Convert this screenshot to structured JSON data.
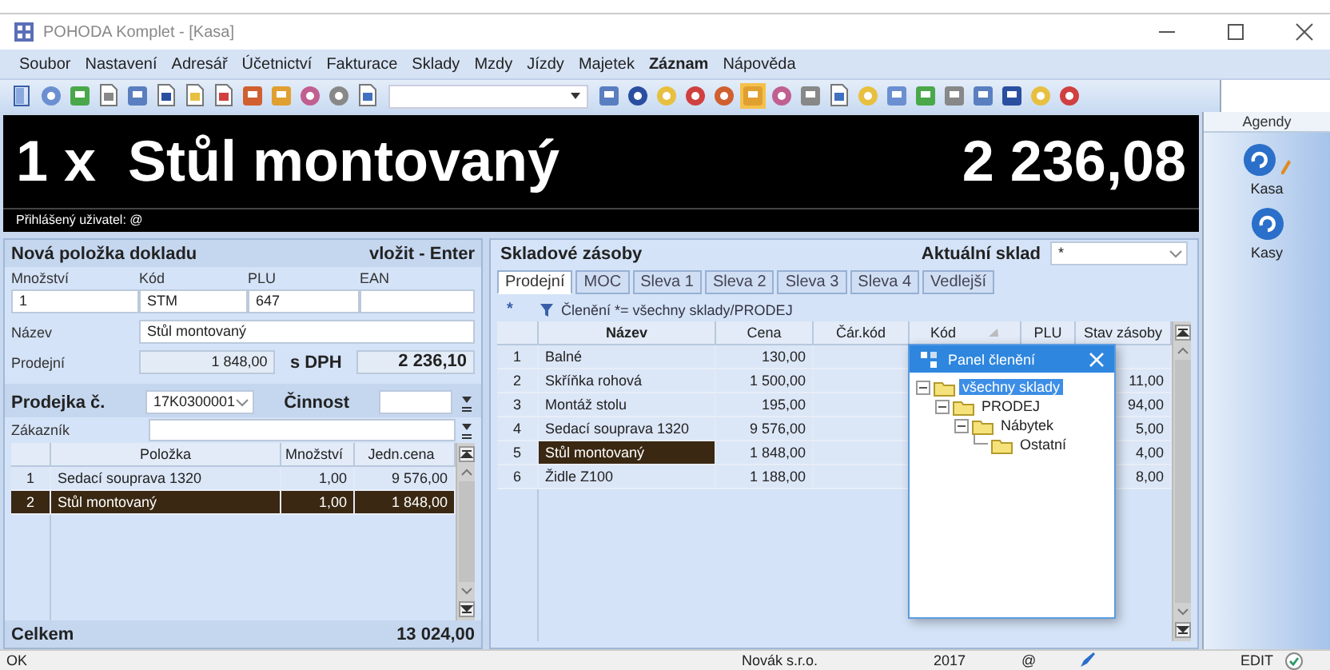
{
  "window": {
    "title": "POHODA Komplet - [Kasa]"
  },
  "menu": [
    {
      "label": "Soubor",
      "bold": false
    },
    {
      "label": "Nastavení",
      "bold": false
    },
    {
      "label": "Adresář",
      "bold": false
    },
    {
      "label": "Účetnictví",
      "bold": false
    },
    {
      "label": "Fakturace",
      "bold": false
    },
    {
      "label": "Sklady",
      "bold": false
    },
    {
      "label": "Mzdy",
      "bold": false
    },
    {
      "label": "Jízdy",
      "bold": false
    },
    {
      "label": "Majetek",
      "bold": false
    },
    {
      "label": "Záznam",
      "bold": true
    },
    {
      "label": "Nápověda",
      "bold": false
    }
  ],
  "display": {
    "item": "1 x  Stůl montovaný",
    "amount": "2 236,08",
    "user_label": "Přihlášený uživatel: @"
  },
  "new_item": {
    "title": "Nová položka dokladu",
    "hint": "vložit - Enter",
    "fields": [
      {
        "label": "Množství",
        "value": "1"
      },
      {
        "label": "Kód",
        "value": "STM"
      },
      {
        "label": "PLU",
        "value": "647"
      },
      {
        "label": "EAN"
      }
    ],
    "name_label": "Název",
    "name_value": "Stůl montovaný",
    "price_label": "Prodejní",
    "price": "1 848,00",
    "vat_label": "s DPH",
    "price_vat": "2 236,10"
  },
  "receipt": {
    "number_label": "Prodejka č.",
    "number": "17K0300001",
    "activity_label": "Činnost",
    "customer_label": "Zákazník",
    "columns": [
      "Položka",
      "Množství",
      "Jedn.cena"
    ],
    "rows": [
      {
        "no": "1",
        "item": "Sedací souprava 1320",
        "qty": "1,00",
        "price": "9 576,00",
        "selected": false
      },
      {
        "no": "2",
        "item": "Stůl montovaný",
        "qty": "1,00",
        "price": "1 848,00",
        "selected": true
      }
    ],
    "total_label": "Celkem",
    "total": "13 024,00"
  },
  "stock": {
    "title": "Skladové zásoby",
    "warehouse_label": "Aktuální sklad",
    "warehouse": "*",
    "tabs": [
      {
        "label": "Prodejní",
        "selected": true
      },
      {
        "label": "MOC",
        "selected": false
      },
      {
        "label": "Sleva 1",
        "selected": false
      },
      {
        "label": "Sleva 2",
        "selected": false
      },
      {
        "label": "Sleva 3",
        "selected": false
      },
      {
        "label": "Sleva 4",
        "selected": false
      },
      {
        "label": "Vedlejší",
        "selected": false
      }
    ],
    "filter_mark": "*",
    "filter": "Členění *= všechny sklady/PRODEJ",
    "columns": [
      {
        "label": "Název",
        "sorted": false
      },
      {
        "label": "Cena",
        "sorted": false
      },
      {
        "label": "Čár.kód",
        "sorted": false
      },
      {
        "label": "Kód",
        "sorted": true
      },
      {
        "label": "PLU",
        "sorted": false
      },
      {
        "label": "Stav zásoby",
        "sorted": false
      }
    ],
    "rows": [
      {
        "no": "1",
        "name": "Balné",
        "price": "130,00",
        "selected": false
      },
      {
        "no": "2",
        "name": "Skříňka rohová",
        "price": "1 500,00",
        "stock": "11,00",
        "selected": false
      },
      {
        "no": "3",
        "name": "Montáž stolu",
        "price": "195,00",
        "stock": "94,00",
        "selected": false
      },
      {
        "no": "4",
        "name": "Sedací souprava 1320",
        "price": "9 576,00",
        "stock": "5,00",
        "selected": false
      },
      {
        "no": "5",
        "name": "Stůl montovaný",
        "price": "1 848,00",
        "stock": "4,00",
        "selected": true
      },
      {
        "no": "6",
        "name": "Židle Z100",
        "price": "1 188,00",
        "stock": "8,00",
        "selected": false
      }
    ]
  },
  "panel": {
    "title": "Panel členění",
    "tree": [
      {
        "label": "všechny sklady",
        "selected": true,
        "children": [
          {
            "label": "PRODEJ",
            "selected": false,
            "children": [
              {
                "label": "Nábytek",
                "selected": false,
                "children": [
                  {
                    "label": "Ostatní",
                    "selected": false
                  }
                ]
              }
            ]
          }
        ]
      }
    ]
  },
  "sidebar": {
    "title": "Agendy",
    "items": [
      {
        "label": "Kasa",
        "kind": "editable"
      },
      {
        "label": "Kasy",
        "kind": "plain"
      }
    ]
  },
  "status_bar": {
    "message": "OK",
    "company": "Novák s.r.o.",
    "year": "2017",
    "user": "@",
    "mode": "EDIT"
  }
}
